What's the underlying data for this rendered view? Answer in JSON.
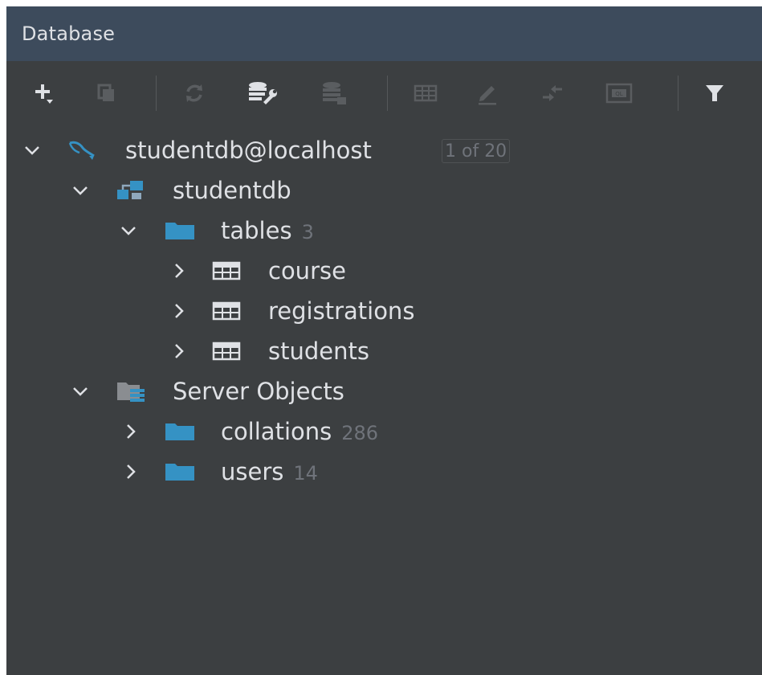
{
  "panel": {
    "title": "Database"
  },
  "toolbar": {
    "buttons": [
      {
        "name": "new",
        "icon": "plus-icon"
      },
      {
        "name": "duplicate",
        "icon": "copy-icon"
      },
      {
        "name": "refresh",
        "icon": "refresh-icon"
      },
      {
        "name": "data-source-properties",
        "icon": "database-wrench-icon"
      },
      {
        "name": "schemas",
        "icon": "database-stack-icon"
      },
      {
        "name": "table-editor",
        "icon": "table-icon"
      },
      {
        "name": "edit-source",
        "icon": "pencil-icon"
      },
      {
        "name": "jump-to-query-console",
        "icon": "arrows-icon"
      },
      {
        "name": "ql-console",
        "icon": "ql-console-icon"
      },
      {
        "name": "filter",
        "icon": "filter-icon"
      }
    ]
  },
  "tree": {
    "connection": {
      "label": "studentdb@localhost",
      "badge": "1 of 20",
      "icon": "mysql-dolphin-icon"
    },
    "schema": {
      "label": "studentdb",
      "icon": "schema-icon"
    },
    "tables_folder": {
      "label": "tables",
      "count": "3",
      "icon": "folder-icon"
    },
    "tables": [
      {
        "label": "course",
        "icon": "table-icon"
      },
      {
        "label": "registrations",
        "icon": "table-icon"
      },
      {
        "label": "students",
        "icon": "table-icon"
      }
    ],
    "server_objects": {
      "label": "Server Objects",
      "icon": "server-objects-icon"
    },
    "collations": {
      "label": "collations",
      "count": "286",
      "icon": "folder-icon"
    },
    "users": {
      "label": "users",
      "count": "14",
      "icon": "folder-icon"
    }
  },
  "colors": {
    "header_bg": "#3d4b5c",
    "panel_bg": "#3c3f41",
    "text": "#dfe1e5",
    "muted": "#6f737a",
    "accent_blue": "#3592c4"
  }
}
